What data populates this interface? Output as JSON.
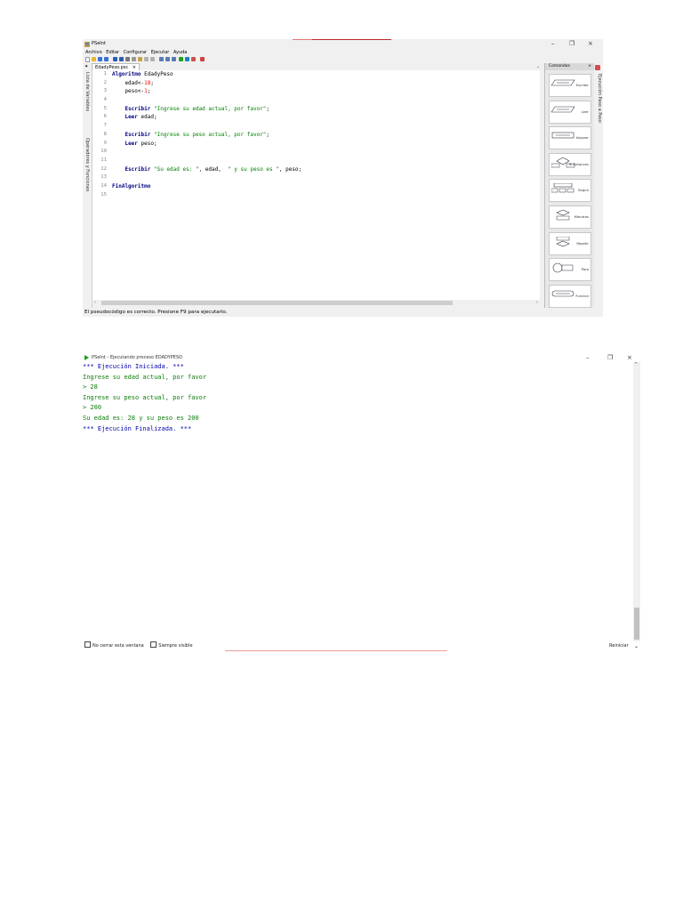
{
  "editor": {
    "title": "PSeInt",
    "menu": [
      "Archivo",
      "Editar",
      "Configurar",
      "Ejecutar",
      "Ayuda"
    ],
    "tab_label": "EdadyPeso.psc",
    "tab_close": "×",
    "side_label_top": "Lista de Variables",
    "side_label_bottom": "Operadores y Funciones",
    "right_side_label": "Ejecución Paso a Paso",
    "code_lines": [
      {
        "n": "1",
        "parts": [
          {
            "t": "Algoritmo",
            "c": "kw"
          },
          {
            "t": " EdadyPeso",
            "c": "plain"
          }
        ]
      },
      {
        "n": "2",
        "parts": [
          {
            "t": "    edad<-",
            "c": "plain"
          },
          {
            "t": "18",
            "c": "num"
          },
          {
            "t": ";",
            "c": "plain"
          }
        ]
      },
      {
        "n": "3",
        "parts": [
          {
            "t": "    peso<-",
            "c": "plain"
          },
          {
            "t": "1",
            "c": "num"
          },
          {
            "t": ";",
            "c": "plain"
          }
        ]
      },
      {
        "n": "4",
        "parts": []
      },
      {
        "n": "5",
        "parts": [
          {
            "t": "    ",
            "c": "plain"
          },
          {
            "t": "Escribir",
            "c": "kw"
          },
          {
            "t": " ",
            "c": "plain"
          },
          {
            "t": "\"Ingrese su edad actual, por favor\"",
            "c": "str"
          },
          {
            "t": ";",
            "c": "plain"
          }
        ]
      },
      {
        "n": "6",
        "parts": [
          {
            "t": "    ",
            "c": "plain"
          },
          {
            "t": "Leer",
            "c": "kw"
          },
          {
            "t": " edad;",
            "c": "plain"
          }
        ]
      },
      {
        "n": "7",
        "parts": []
      },
      {
        "n": "8",
        "parts": [
          {
            "t": "    ",
            "c": "plain"
          },
          {
            "t": "Escribir",
            "c": "kw"
          },
          {
            "t": " ",
            "c": "plain"
          },
          {
            "t": "\"Ingrese su peso actual, por favor\"",
            "c": "str"
          },
          {
            "t": ";",
            "c": "plain"
          }
        ]
      },
      {
        "n": "9",
        "parts": [
          {
            "t": "    ",
            "c": "plain"
          },
          {
            "t": "Leer",
            "c": "kw"
          },
          {
            "t": " peso;",
            "c": "plain"
          }
        ]
      },
      {
        "n": "10",
        "parts": []
      },
      {
        "n": "11",
        "parts": []
      },
      {
        "n": "12",
        "parts": [
          {
            "t": "    ",
            "c": "plain"
          },
          {
            "t": "Escribir",
            "c": "kw"
          },
          {
            "t": " ",
            "c": "plain"
          },
          {
            "t": "\"Su edad es: \"",
            "c": "str"
          },
          {
            "t": ", edad,  ",
            "c": "plain"
          },
          {
            "t": "\" y su peso es \"",
            "c": "str"
          },
          {
            "t": ", peso;",
            "c": "plain"
          }
        ]
      },
      {
        "n": "13",
        "parts": []
      },
      {
        "n": "14",
        "parts": [
          {
            "t": "FinAlgoritmo",
            "c": "kw"
          }
        ]
      },
      {
        "n": "15",
        "parts": []
      }
    ],
    "status": "El pseudocódigo es correcto. Presione F9 para ejecutarlo.",
    "commands_panel": {
      "title": "Comandos",
      "close": "×",
      "items": [
        "Escribir",
        "Leer",
        "Asignar",
        "Si-Entonces",
        "Segun",
        "Mientras",
        "Repetir",
        "Para",
        "Funcion"
      ]
    },
    "colors": {
      "keyword": "#000080",
      "string": "#008000",
      "number": "#ff0000"
    }
  },
  "console": {
    "title": "PSeInt - Ejecutando proceso EDADYPESO",
    "lines": [
      {
        "t": "*** Ejecución Iniciada. ***",
        "c": "blue"
      },
      {
        "t": "Ingrese su edad actual, por favor",
        "c": "green"
      },
      {
        "t": "> 28",
        "c": "green"
      },
      {
        "t": "Ingrese su peso actual, por favor",
        "c": "green"
      },
      {
        "t": "> 200",
        "c": "green"
      },
      {
        "t": "Su edad es: 28 y su peso es 200",
        "c": "green"
      },
      {
        "t": "*** Ejecución Finalizada. ***",
        "c": "blue"
      }
    ],
    "checkbox_no_cerrar": "No cerrar esta ventana",
    "checkbox_siempre_visible": "Siempre visible",
    "restart_button": "Reiniciar"
  }
}
